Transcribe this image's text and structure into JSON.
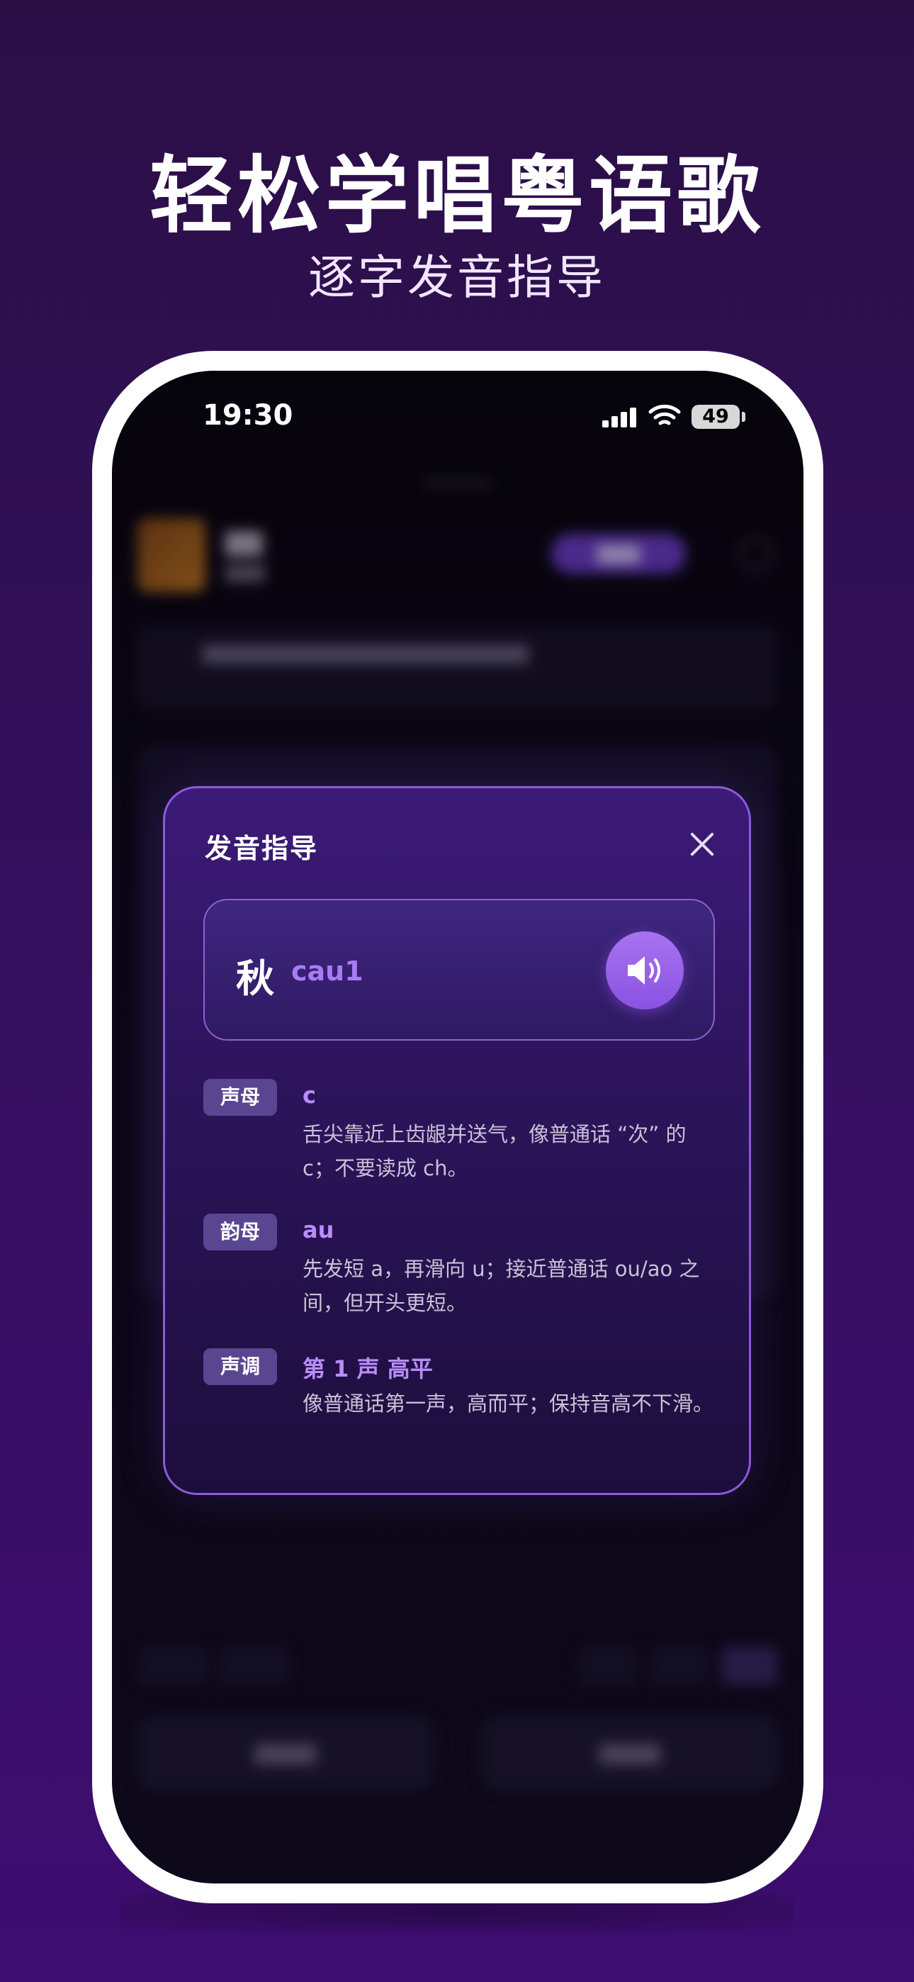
{
  "headline": "轻松学唱粤语歌",
  "subheadline": "逐字发音指导",
  "status_bar": {
    "time": "19:30",
    "battery": "49"
  },
  "dialog": {
    "title": "发音指导",
    "character": "秋",
    "jyutping": "cau1",
    "sections": [
      {
        "tag": "声母",
        "head": "c",
        "desc": "舌尖靠近上齿龈并送气，像普通话 “次” 的 c；不要读成 ch。"
      },
      {
        "tag": "韵母",
        "head": "au",
        "desc": "先发短 a，再滑向 u；接近普通话 ou/ao 之间，但开头更短。"
      },
      {
        "tag": "声调",
        "head": "第 1 声 高平",
        "desc": "像普通话第一声，高而平；保持音高不下滑。"
      }
    ]
  },
  "colors": {
    "accent": "#a774f0",
    "jyutping": "#a97cf3",
    "tag_bg": "#5a4690",
    "dialog_border": "#8c5bd6"
  },
  "icons": {
    "close": "close-icon",
    "play": "speaker-icon"
  }
}
